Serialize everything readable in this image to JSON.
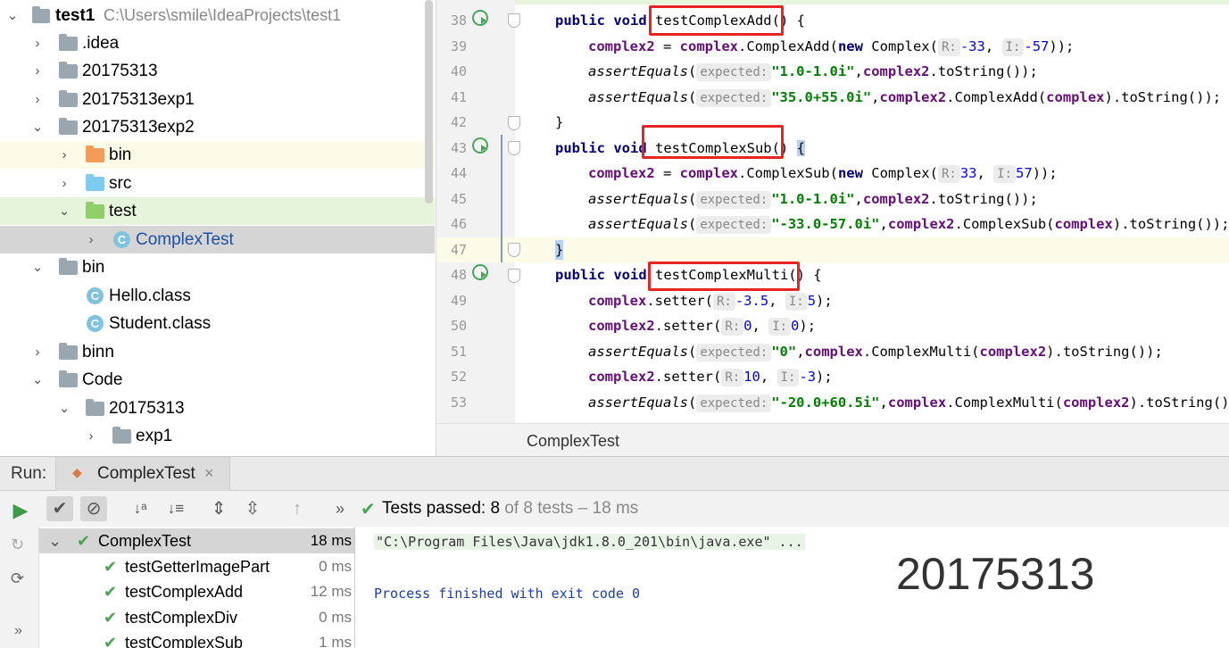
{
  "project_tree": {
    "root": {
      "name": "test1",
      "path": "C:\\Users\\smile\\IdeaProjects\\test1"
    },
    "items": [
      {
        "label": "20175313exp1"
      },
      {
        "label": ".idea"
      },
      {
        "label": "20175313"
      },
      {
        "label": "20175313exp2"
      },
      {
        "label": "bin"
      },
      {
        "label": "src"
      },
      {
        "label": "test"
      },
      {
        "label": "ComplexTest"
      },
      {
        "label": "bin"
      },
      {
        "label": "Hello.class"
      },
      {
        "label": "Student.class"
      },
      {
        "label": "binn"
      },
      {
        "label": "Code"
      },
      {
        "label": "20175313"
      },
      {
        "label": "exp1"
      }
    ]
  },
  "editor": {
    "tab_label": "ComplexTest",
    "lines": [
      "38",
      "39",
      "40",
      "41",
      "42",
      "43",
      "44",
      "45",
      "46",
      "47",
      "48",
      "49",
      "50",
      "51",
      "52",
      "53"
    ],
    "code": {
      "l38_kw": "public void ",
      "l38_name": "testComplexAdd",
      "l38_rest": "() {",
      "l39_a": "complex2",
      "l39_b": " = ",
      "l39_c": "complex",
      "l39_d": ".ComplexAdd(",
      "l39_e": "new",
      "l39_f": " Complex(",
      "l39_h1": "R:",
      "l39_n1": "-33",
      "l39_sep": ", ",
      "l39_h2": "I:",
      "l39_n2": "-57",
      "l39_end": "));",
      "l40_a": "assertEquals",
      "l40_b": "(",
      "l40_h": "expected:",
      "l40_s": "\"1.0-1.0i\"",
      "l40_c": ",",
      "l40_d": "complex2",
      "l40_e": ".toString());",
      "l41_a": "assertEquals",
      "l41_b": "(",
      "l41_h": "expected:",
      "l41_s": "\"35.0+55.0i\"",
      "l41_c": ",",
      "l41_d": "complex2",
      "l41_e": ".ComplexAdd(",
      "l41_f": "complex",
      "l41_g": ").toString());",
      "l42": "}",
      "l43_kw": "public void ",
      "l43_name": "testComplexSub",
      "l43_rest": "() ",
      "l43_brace": "{",
      "l44_a": "complex2",
      "l44_b": " = ",
      "l44_c": "complex",
      "l44_d": ".ComplexSub(",
      "l44_e": "new",
      "l44_f": " Complex(",
      "l44_h1": "R:",
      "l44_n1": "33",
      "l44_sep": ", ",
      "l44_h2": "I:",
      "l44_n2": "57",
      "l44_end": "));",
      "l45_a": "assertEquals",
      "l45_b": "(",
      "l45_h": "expected:",
      "l45_s": "\"1.0-1.0i\"",
      "l45_c": ",",
      "l45_d": "complex2",
      "l45_e": ".toString());",
      "l46_a": "assertEquals",
      "l46_b": "(",
      "l46_h": "expected:",
      "l46_s": "\"-33.0-57.0i\"",
      "l46_c": ",",
      "l46_d": "complex2",
      "l46_e": ".ComplexSub(",
      "l46_f": "complex",
      "l46_g": ").toString());",
      "l47": "}",
      "l48_kw": "public void ",
      "l48_name": "testComplexMulti",
      "l48_rest": "() {",
      "l49_a": "complex",
      "l49_b": ".setter(",
      "l49_h1": "R:",
      "l49_n1": "-3.5",
      "l49_sep": ", ",
      "l49_h2": "I:",
      "l49_n2": "5",
      "l49_end": ");",
      "l50_a": "complex2",
      "l50_b": ".setter(",
      "l50_h1": "R:",
      "l50_n1": "0",
      "l50_sep": ", ",
      "l50_h2": "I:",
      "l50_n2": "0",
      "l50_end": ");",
      "l51_a": "assertEquals",
      "l51_b": "(",
      "l51_h": "expected:",
      "l51_s": "\"0\"",
      "l51_c": ",",
      "l51_d": "complex",
      "l51_e": ".ComplexMulti(",
      "l51_f": "complex2",
      "l51_g": ").toString());",
      "l52_a": "complex2",
      "l52_b": ".setter(",
      "l52_h1": "R:",
      "l52_n1": "10",
      "l52_sep": ", ",
      "l52_h2": "I:",
      "l52_n2": "-3",
      "l52_end": ");",
      "l53_a": "assertEquals",
      "l53_b": "(",
      "l53_h": "expected:",
      "l53_s": "\"-20.0+60.5i\"",
      "l53_c": ",",
      "l53_d": "complex",
      "l53_e": ".ComplexMulti(",
      "l53_f": "complex2",
      "l53_g": ").toString())"
    }
  },
  "run_panel": {
    "run_label": "Run:",
    "tab_label": "ComplexTest",
    "status_prefix": "Tests passed: ",
    "status_count": "8",
    "status_suffix": " of 8 tests – 18 ms",
    "tests": [
      {
        "name": "ComplexTest",
        "duration": "18 ms"
      },
      {
        "name": "testGetterImagePart",
        "duration": "0 ms"
      },
      {
        "name": "testComplexAdd",
        "duration": "12 ms"
      },
      {
        "name": "testComplexDiv",
        "duration": "0 ms"
      },
      {
        "name": "testComplexSub",
        "duration": "1 ms"
      }
    ],
    "console_cmd": "\"C:\\Program Files\\Java\\jdk1.8.0_201\\bin\\java.exe\" ...",
    "console_exit": "Process finished with exit code 0",
    "watermark": "20175313"
  },
  "colors": {
    "pass_green": "#4ba54f",
    "highlight_red": "#e82323",
    "keyword": "#000080",
    "field": "#660e7a",
    "string": "#008000"
  }
}
